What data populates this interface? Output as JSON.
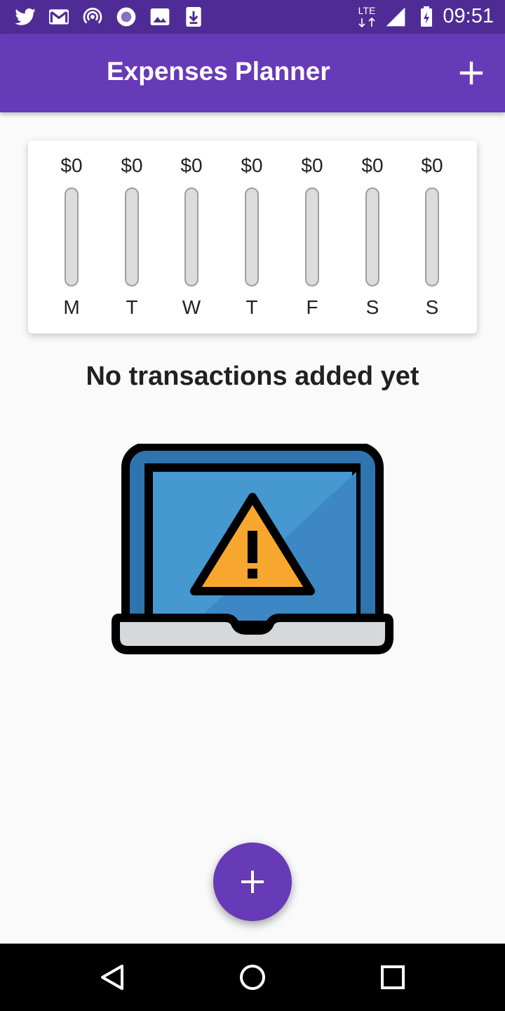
{
  "status_bar": {
    "time": "09:51",
    "network": "LTE",
    "icons": [
      "twitter-icon",
      "gmail-icon",
      "hotspot-icon",
      "record-icon",
      "image-icon",
      "download-icon",
      "lte-icon",
      "signal-icon",
      "battery-charging-icon"
    ]
  },
  "app_bar": {
    "title": "Expenses Planner",
    "action_icon": "add-icon"
  },
  "chart": {
    "days": [
      {
        "label": "M",
        "amount": "$0",
        "fill": 0
      },
      {
        "label": "T",
        "amount": "$0",
        "fill": 0
      },
      {
        "label": "W",
        "amount": "$0",
        "fill": 0
      },
      {
        "label": "T",
        "amount": "$0",
        "fill": 0
      },
      {
        "label": "F",
        "amount": "$0",
        "fill": 0
      },
      {
        "label": "S",
        "amount": "$0",
        "fill": 0
      },
      {
        "label": "S",
        "amount": "$0",
        "fill": 0
      }
    ]
  },
  "empty_state": {
    "message": "No transactions added yet",
    "illustration": "laptop-warning-icon"
  },
  "fab": {
    "icon": "add-icon"
  },
  "nav_bar": {
    "icons": [
      "back-icon",
      "home-icon",
      "recents-icon"
    ]
  },
  "colors": {
    "primary": "#673ab7",
    "status_bar": "#4f2c95",
    "background": "#fafafa",
    "screen_blue": "#4598d0",
    "warning_orange": "#f8a72e"
  }
}
